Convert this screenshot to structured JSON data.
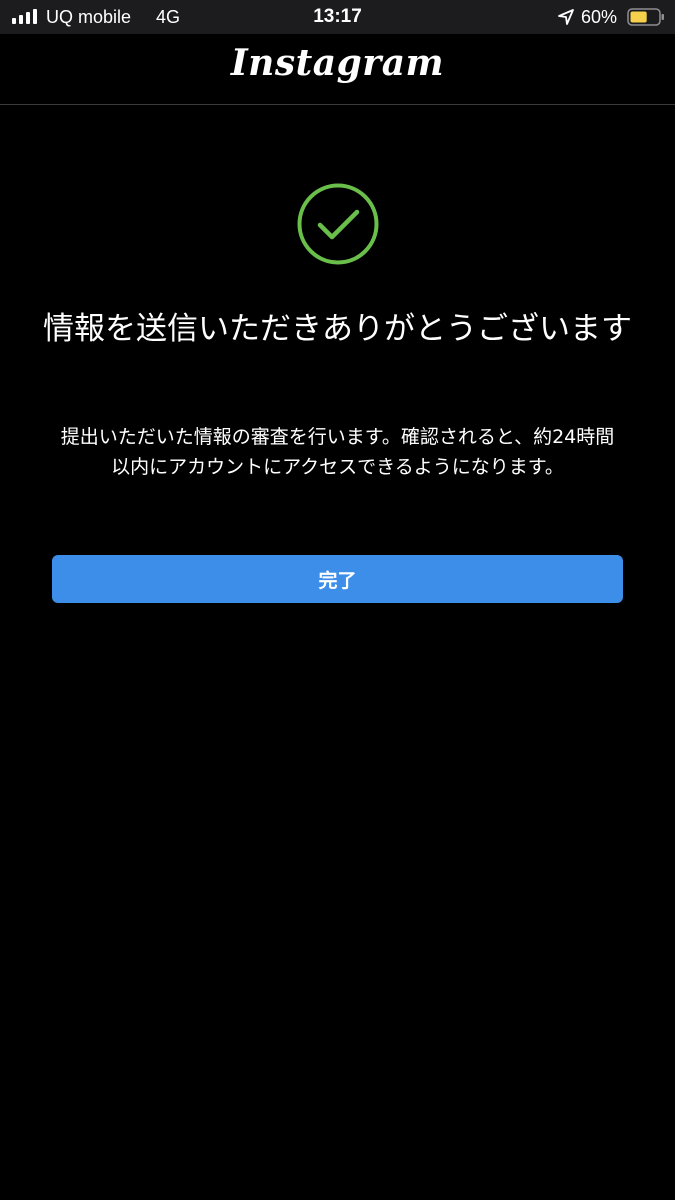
{
  "status_bar": {
    "carrier": "UQ mobile",
    "network": "4G",
    "time": "13:17",
    "battery_percent": "60%",
    "battery_level": 0.6,
    "icons": [
      "signal-icon",
      "location-arrow-icon",
      "battery-icon"
    ]
  },
  "header": {
    "logo_text": "Instagram"
  },
  "main": {
    "status_icon": "check-circle-icon",
    "title": "情報を送信いただきありがとうございます",
    "description": "提出いただいた情報の審査を行います。確認されると、約24時間以内にアカウントにアクセスできるようになります。",
    "done_label": "完了"
  },
  "colors": {
    "background": "#000000",
    "status_bar": "#1c1c1e",
    "check_green": "#6abf4b",
    "button_blue": "#3d8ee9",
    "battery_yellow": "#f5d04a"
  }
}
